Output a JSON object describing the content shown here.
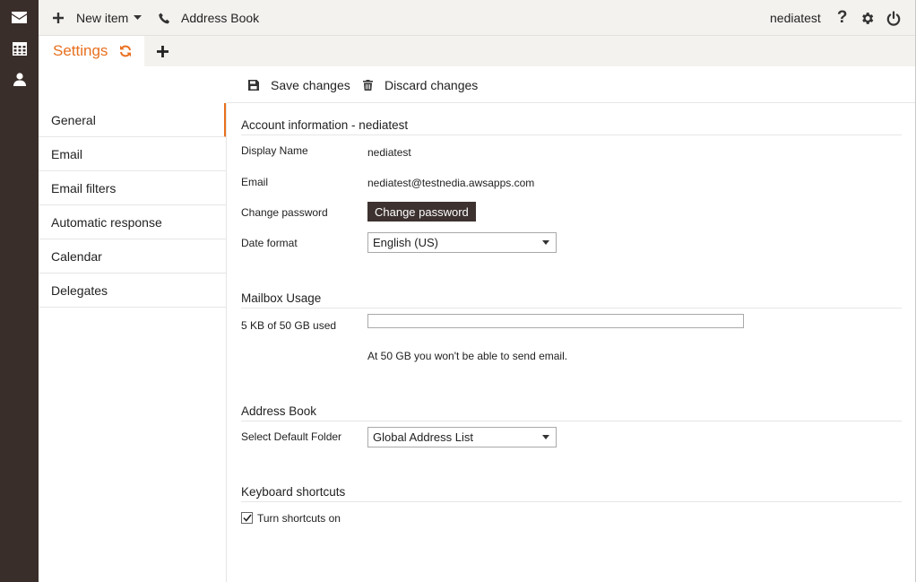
{
  "rail": {
    "icons": [
      "mail-icon",
      "calendar-icon",
      "contacts-icon"
    ]
  },
  "topbar": {
    "new_item_label": "New item",
    "address_book_label": "Address Book",
    "username": "nediatest"
  },
  "tabs": {
    "active_label": "Settings"
  },
  "toolbar": {
    "save_label": "Save changes",
    "discard_label": "Discard changes"
  },
  "sidebar": {
    "items": [
      {
        "label": "General",
        "active": true
      },
      {
        "label": "Email"
      },
      {
        "label": "Email filters"
      },
      {
        "label": "Automatic response"
      },
      {
        "label": "Calendar"
      },
      {
        "label": "Delegates"
      }
    ]
  },
  "account": {
    "title": "Account information - nediatest",
    "display_name_label": "Display Name",
    "display_name_value": "nediatest",
    "email_label": "Email",
    "email_value": "nediatest@testnedia.awsapps.com",
    "change_password_label": "Change password",
    "change_password_button": "Change password",
    "date_format_label": "Date format",
    "date_format_value": "English (US)"
  },
  "mailbox": {
    "title": "Mailbox Usage",
    "usage_label": "5 KB of 50 GB used",
    "usage_fraction": 0,
    "note": "At 50 GB you won't be able to send email."
  },
  "address_book": {
    "title": "Address Book",
    "default_folder_label": "Select Default Folder",
    "default_folder_value": "Global Address List"
  },
  "keyboard": {
    "title": "Keyboard shortcuts",
    "shortcuts_label": "Turn shortcuts on",
    "shortcuts_checked": true
  },
  "colors": {
    "accent": "#e8701f",
    "rail_bg": "#3a2e2a",
    "topbar_bg": "#f4f2ef",
    "dark_button": "#3d3230"
  }
}
